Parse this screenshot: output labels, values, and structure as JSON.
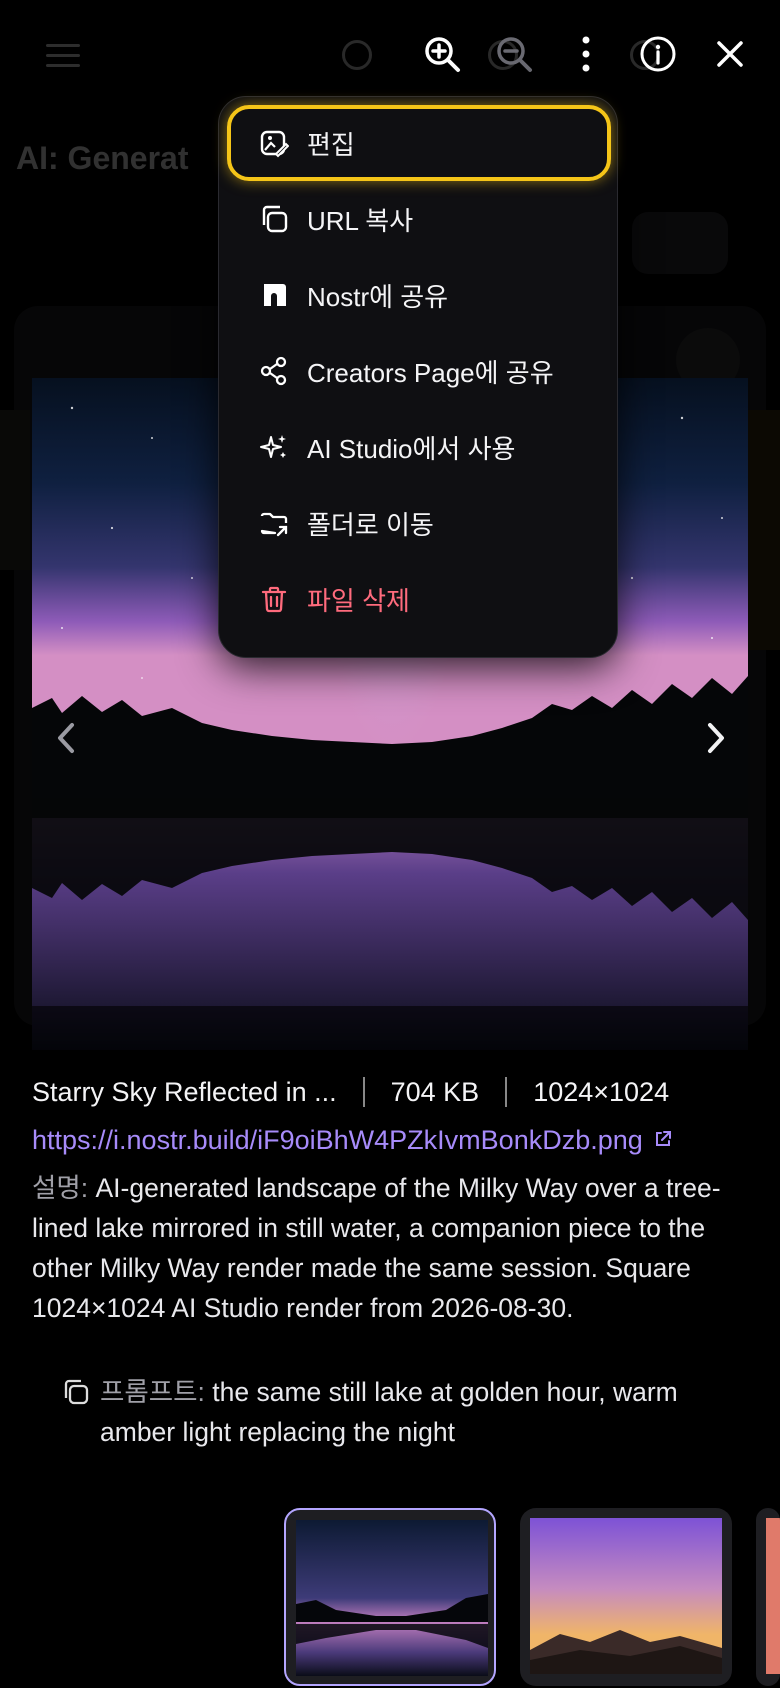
{
  "background": {
    "page_title": "AI: Generat"
  },
  "viewer": {
    "image_name": "Starry Sky Reflected in ...",
    "file_size": "704 KB",
    "dimensions": "1024×1024",
    "url": "https://i.nostr.build/iF9oiBhW4PZkIvmBonkDzb.png",
    "description_label": "설명:",
    "description": "AI-generated landscape of the Milky Way over a tree-lined lake mirrored in still water, a companion piece to the other Milky Way render made the same session. Square 1024×1024 AI Studio render from 2026-08-30.",
    "prompt_label": "프롬프트:",
    "prompt": "the same still lake at golden hour, warm amber light replacing the night"
  },
  "toolbar": {
    "icons": [
      "zoom-in-icon",
      "zoom-out-icon",
      "more-vertical-icon",
      "info-icon",
      "close-icon"
    ]
  },
  "menu": {
    "items": [
      {
        "label": "편집",
        "icon": "image-edit-icon"
      },
      {
        "label": "URL 복사",
        "icon": "copy-icon"
      },
      {
        "label": "Nostr에 공유",
        "icon": "nostr-icon"
      },
      {
        "label": "Creators Page에 공유",
        "icon": "share-icon"
      },
      {
        "label": "AI Studio에서 사용",
        "icon": "sparkles-icon"
      },
      {
        "label": "폴더로 이동",
        "icon": "folder-move-icon"
      },
      {
        "label": "파일 삭제",
        "icon": "trash-icon"
      }
    ]
  },
  "thumbnails": [
    {
      "name": "milky-way-lake",
      "selected": true
    },
    {
      "name": "golden-hour-lake",
      "selected": false
    }
  ],
  "colors": {
    "accent": "#a78bfa",
    "focus_ring": "#f5c518",
    "danger": "#ff6b7d"
  }
}
